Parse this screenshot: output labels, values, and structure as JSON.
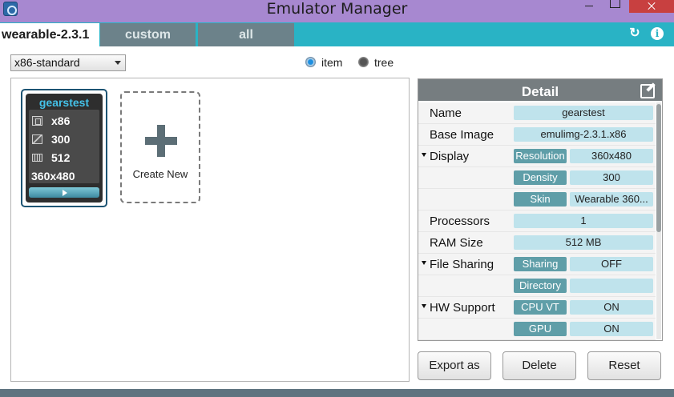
{
  "window": {
    "title": "Emulator Manager"
  },
  "tabs": [
    {
      "label": "wearable-2.3.1",
      "active": true
    },
    {
      "label": "custom",
      "active": false
    },
    {
      "label": "all",
      "active": false
    }
  ],
  "tab_icons": [
    "refresh-icon",
    "info-icon"
  ],
  "toolbar": {
    "template_select": "x86-standard",
    "view_mode": {
      "options": [
        "item",
        "tree"
      ],
      "selected": "item"
    }
  },
  "vm_card": {
    "name": "gearstest",
    "specs": [
      {
        "icon": "cpu-icon",
        "value": "x86"
      },
      {
        "icon": "image-icon",
        "value": "300"
      },
      {
        "icon": "ram-icon",
        "value": "512"
      }
    ],
    "resolution": "360x480"
  },
  "create_new": {
    "label": "Create New"
  },
  "detail": {
    "title": "Detail",
    "rows": {
      "name": {
        "label": "Name",
        "value": "gearstest"
      },
      "base_image": {
        "label": "Base Image",
        "value": "emulimg-2.3.1.x86"
      },
      "display": {
        "label": "Display",
        "resolution_label": "Resolution",
        "resolution": "360x480",
        "density_label": "Density",
        "density": "300",
        "skin_label": "Skin",
        "skin": "Wearable 360..."
      },
      "processors": {
        "label": "Processors",
        "value": "1"
      },
      "ram": {
        "label": "RAM Size",
        "value": "512 MB"
      },
      "file_sharing": {
        "label": "File Sharing",
        "sharing_label": "Sharing",
        "sharing": "OFF",
        "directory_label": "Directory",
        "directory": ""
      },
      "hw_support": {
        "label": "HW Support",
        "cpu_vt_label": "CPU VT",
        "cpu_vt": "ON",
        "gpu_label": "GPU",
        "gpu": "ON"
      }
    }
  },
  "buttons": {
    "export": "Export as",
    "delete": "Delete",
    "reset": "Reset"
  },
  "colors": {
    "titlebar": "#a788d0",
    "tabbar": "#29b3c5",
    "value_bg": "#bfe3ec",
    "sublabel_bg": "#5f9ea8"
  }
}
